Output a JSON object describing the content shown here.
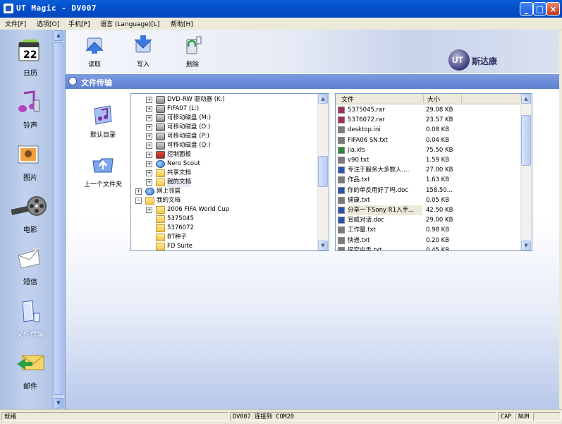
{
  "window": {
    "title": "UT Magic - DV007"
  },
  "menu": [
    "文件[F]",
    "选项[O]",
    "手机[P]",
    "语言 (Language)[L]",
    "帮助[H]"
  ],
  "sidebar": [
    {
      "label": "日历",
      "icon": "calendar-icon",
      "badge": "22"
    },
    {
      "label": "铃声",
      "icon": "music-note-icon"
    },
    {
      "label": "图片",
      "icon": "picture-icon"
    },
    {
      "label": "电影",
      "icon": "film-reel-icon"
    },
    {
      "label": "短信",
      "icon": "envelope-icon"
    },
    {
      "label": "文件传输",
      "icon": "file-transfer-icon",
      "active": true
    },
    {
      "label": "邮件",
      "icon": "mail-icon"
    }
  ],
  "toolbar": {
    "read": "读取",
    "write": "写入",
    "delete": "删除",
    "brand": "斯达康",
    "brand_mark": "UT"
  },
  "section": {
    "title": "文件传输"
  },
  "quick": {
    "default_dir": "默认目录",
    "parent_dir": "上一个文件夹"
  },
  "tree": [
    {
      "label": "DVD-RW 驱动器 (K:)",
      "level": 2,
      "exp": "+",
      "icon": "drive"
    },
    {
      "label": "FIFA07 (L:)",
      "level": 2,
      "exp": "+",
      "icon": "drive"
    },
    {
      "label": "可移动磁盘 (M:)",
      "level": 2,
      "exp": "+",
      "icon": "drive"
    },
    {
      "label": "可移动磁盘 (O:)",
      "level": 2,
      "exp": "+",
      "icon": "drive"
    },
    {
      "label": "可移动磁盘 (P:)",
      "level": 2,
      "exp": "+",
      "icon": "drive"
    },
    {
      "label": "可移动磁盘 (Q:)",
      "level": 2,
      "exp": "+",
      "icon": "drive"
    },
    {
      "label": "控制面板",
      "level": 2,
      "exp": "+",
      "icon": "panel"
    },
    {
      "label": "Nero Scout",
      "level": 2,
      "exp": "+",
      "icon": "globe"
    },
    {
      "label": "共享文档",
      "level": 2,
      "exp": "+",
      "icon": "folder"
    },
    {
      "label": "我的文档",
      "level": 2,
      "exp": "+",
      "icon": "folder",
      "selected": true
    },
    {
      "label": "网上邻居",
      "level": 1,
      "exp": "+",
      "icon": "globe"
    },
    {
      "label": "我的文档",
      "level": 1,
      "exp": "−",
      "icon": "folder"
    },
    {
      "label": "2006 FIFA World Cup",
      "level": 2,
      "exp": "+",
      "icon": "folder"
    },
    {
      "label": "5375045",
      "level": 2,
      "exp": "",
      "icon": "folder"
    },
    {
      "label": "5376072",
      "level": 2,
      "exp": "",
      "icon": "folder"
    },
    {
      "label": "BT种子",
      "level": 2,
      "exp": "",
      "icon": "folder"
    },
    {
      "label": "FD Suite",
      "level": 2,
      "exp": "",
      "icon": "folder"
    }
  ],
  "files": {
    "col_name": "文件",
    "col_size": "大小",
    "rows": [
      {
        "name": "5375045.rar",
        "size": "29.08 KB",
        "color": "#a03060"
      },
      {
        "name": "5376072.rar",
        "size": "23.57 KB",
        "color": "#a03060"
      },
      {
        "name": "desktop.ini",
        "size": "0.08 KB",
        "color": "#7a7a7a"
      },
      {
        "name": "FIFA06 SN.txt",
        "size": "0.04 KB",
        "color": "#7a7a7a"
      },
      {
        "name": "jia.xls",
        "size": "75.50 KB",
        "color": "#2e8a3c"
      },
      {
        "name": "v90.txt",
        "size": "1.59 KB",
        "color": "#7a7a7a"
      },
      {
        "name": "专注于服务大多数人....",
        "size": "27.00 KB",
        "color": "#2a52b0"
      },
      {
        "name": "作品.txt",
        "size": "1.63 KB",
        "color": "#7a7a7a"
      },
      {
        "name": "你的单反用好了吗.doc",
        "size": "158.50...",
        "color": "#2a52b0"
      },
      {
        "name": "健康.txt",
        "size": "0.05 KB",
        "color": "#7a7a7a"
      },
      {
        "name": "分享一下Sony R1入手...",
        "size": "42.50 KB",
        "color": "#2a52b0",
        "hl": true
      },
      {
        "name": "宣威对话.doc",
        "size": "29.00 KB",
        "color": "#2a52b0"
      },
      {
        "name": "工作量.txt",
        "size": "0.98 KB",
        "color": "#7a7a7a"
      },
      {
        "name": "快递.txt",
        "size": "0.20 KB",
        "color": "#7a7a7a"
      },
      {
        "name": "探究中手.txt",
        "size": "0.45 KB",
        "color": "#7a7a7a"
      }
    ]
  },
  "status": {
    "left": "就绪",
    "center": "DV007 连接到 COM20",
    "caps": "CAP",
    "num": "NUM"
  }
}
